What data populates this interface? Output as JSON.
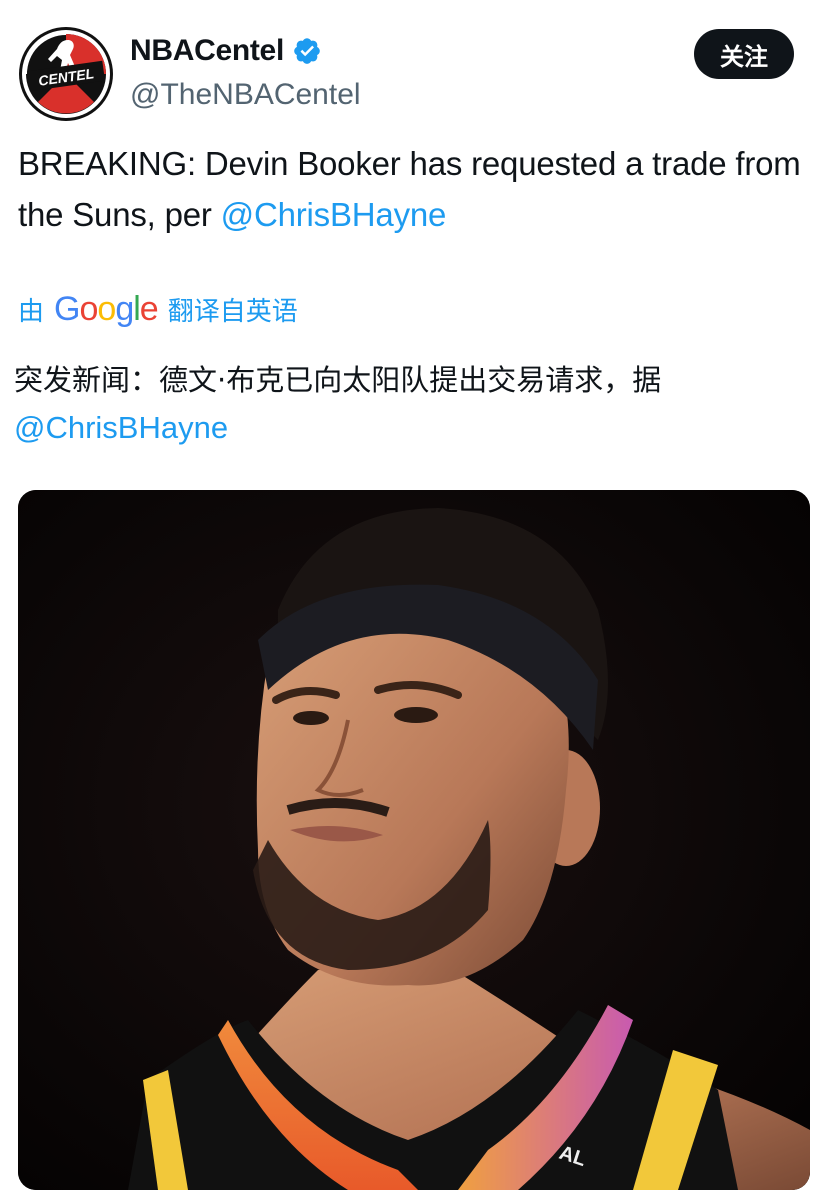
{
  "author": {
    "display_name": "NBACentel",
    "handle": "@TheNBACentel",
    "verified": true,
    "avatar_text": "CENTEL"
  },
  "actions": {
    "follow_label": "关注"
  },
  "tweet": {
    "text_before": "BREAKING: Devin Booker has requested a trade from the Suns, per ",
    "mention": "@ChrisBHayne"
  },
  "translation": {
    "by_label": "由",
    "google_label": "Google",
    "translated_from": "翻译自英语",
    "text_before": "突发新闻：德文·布克已向太阳队提出交易请求，据",
    "mention": "@ChrisBHayne"
  },
  "media": {
    "jersey_tag": "AL"
  },
  "colors": {
    "link": "#1d9bf0",
    "text": "#0f1419",
    "secondary": "#536471",
    "button_bg": "#0f1419",
    "verified": "#1d9bf0"
  }
}
